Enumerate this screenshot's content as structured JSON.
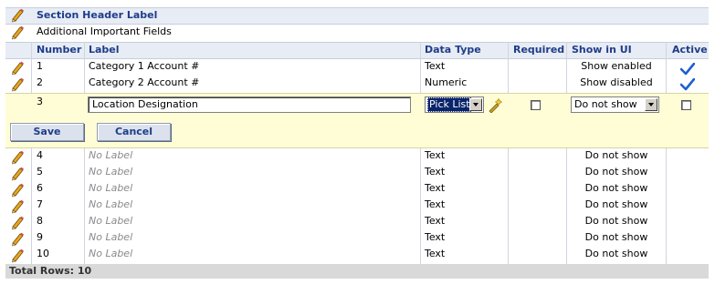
{
  "section": {
    "header_label": "Section Header Label",
    "sub_label": "Additional Important Fields"
  },
  "columns": {
    "number": "Number",
    "label": "Label",
    "data_type": "Data Type",
    "required": "Required",
    "show_in_ui": "Show in UI",
    "active": "Active"
  },
  "rows_top": [
    {
      "number": "1",
      "label": "Category 1 Account #",
      "data_type": "Text",
      "show_in_ui": "Show enabled",
      "active": true
    },
    {
      "number": "2",
      "label": "Category 2 Account #",
      "data_type": "Numeric",
      "show_in_ui": "Show disabled",
      "active": true
    }
  ],
  "edit_row": {
    "number": "3",
    "label_value": "Location Designation",
    "data_type_value": "Pick List",
    "show_in_ui_value": "Do not show",
    "required_checked": false,
    "active_checked": false,
    "save_label": "Save",
    "cancel_label": "Cancel"
  },
  "rows_bottom": [
    {
      "number": "4",
      "label": "No Label",
      "data_type": "Text",
      "show_in_ui": "Do not show"
    },
    {
      "number": "5",
      "label": "No Label",
      "data_type": "Text",
      "show_in_ui": "Do not show"
    },
    {
      "number": "6",
      "label": "No Label",
      "data_type": "Text",
      "show_in_ui": "Do not show"
    },
    {
      "number": "7",
      "label": "No Label",
      "data_type": "Text",
      "show_in_ui": "Do not show"
    },
    {
      "number": "8",
      "label": "No Label",
      "data_type": "Text",
      "show_in_ui": "Do not show"
    },
    {
      "number": "9",
      "label": "No Label",
      "data_type": "Text",
      "show_in_ui": "Do not show"
    },
    {
      "number": "10",
      "label": "No Label",
      "data_type": "Text",
      "show_in_ui": "Do not show"
    }
  ],
  "footer": {
    "total_rows": "Total Rows: 10"
  },
  "colors": {
    "header_bg": "#e7ecf5",
    "edit_bg": "#fffdd6",
    "footer_bg": "#d9d9d9",
    "header_text": "#1f3c88",
    "check": "#1f5fd0"
  },
  "icons": {
    "edit": "pencil-icon",
    "active": "checkmark-icon",
    "picklist_edit": "edit-list-icon"
  }
}
